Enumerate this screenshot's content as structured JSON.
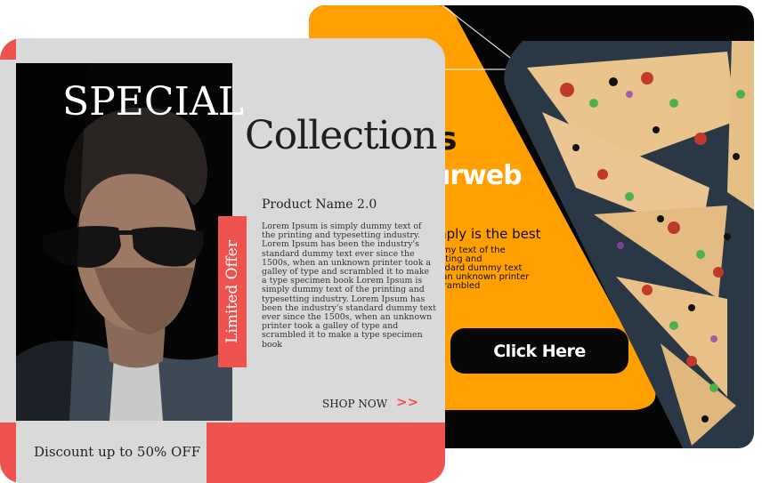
{
  "back_banner": {
    "title_partial": "s",
    "subtitle_partial": "urweb",
    "tagline_partial": "mply is the best",
    "body_partial": "mmy text of the\nrinting and\nandard dummy text\na an unknown printer\nscrambled",
    "button_label": "Click Here"
  },
  "front_banner": {
    "headline": "SPECIAL",
    "collection": "Collection",
    "limited_offer": "Limited Offer",
    "product_name": "Product Name 2.0",
    "description": "Lorem Ipsum is simply dummy text of the printing and typesetting industry. Lorem Ipsum has been the industry's standard dummy text ever since the 1500s, when an unknown printer took a galley of type and scrambled it to make a type specimen book Lorem Ipsum is simply dummy text of the printing and typesetting industry. Lorem Ipsum has been the industry's standard dummy text ever since the 1500s, when an unknown printer took a galley of type and scrambled it to make a type specimen book",
    "shop_now": "SHOP NOW",
    "arrows": ">>",
    "discount": "Discount up to 50% OFF"
  },
  "colors": {
    "accent_red": "#ef5350",
    "orange": "#ff9f00",
    "card_gray": "#d9d9d9",
    "black": "#050505"
  }
}
